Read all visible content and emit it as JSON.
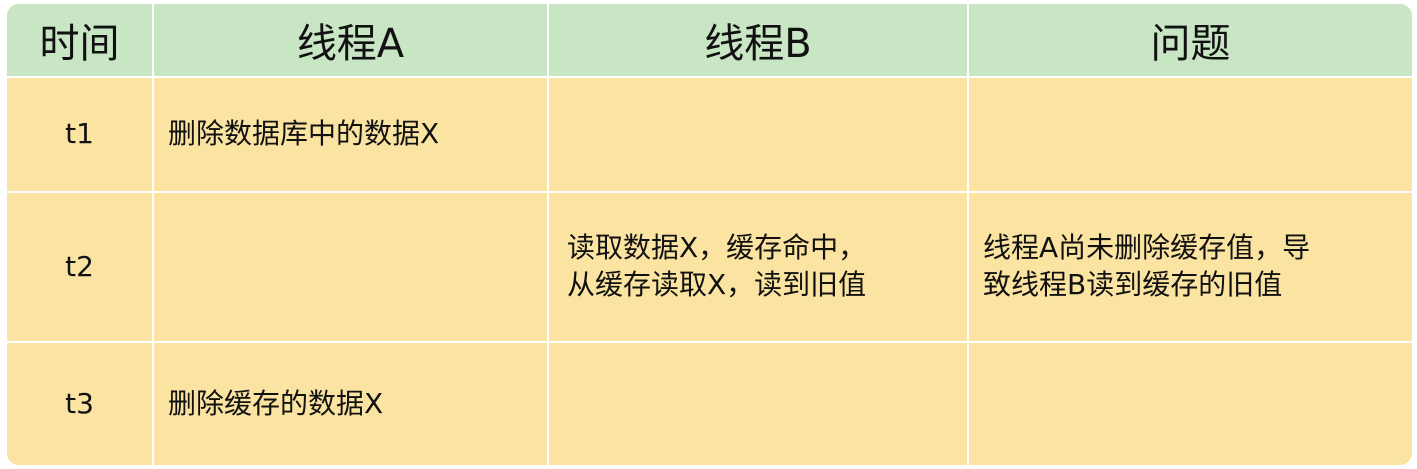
{
  "table": {
    "headers": [
      "时间",
      "线程A",
      "线程B",
      "问题"
    ],
    "rows": [
      {
        "time": "t1",
        "thread_a": "删除数据库中的数据X",
        "thread_b": "",
        "problem": ""
      },
      {
        "time": "t2",
        "thread_a": "",
        "thread_b": "读取数据X，缓存命中，\n从缓存读取X，读到旧值",
        "problem": "线程A尚未删除缓存值，导\n致线程B读到缓存的旧值"
      },
      {
        "time": "t3",
        "thread_a": "删除缓存的数据X",
        "thread_b": "",
        "problem": ""
      }
    ]
  },
  "colors": {
    "header_bg": "#c8e6c4",
    "body_bg": "#fbe3a1",
    "divider": "#ffffff"
  }
}
